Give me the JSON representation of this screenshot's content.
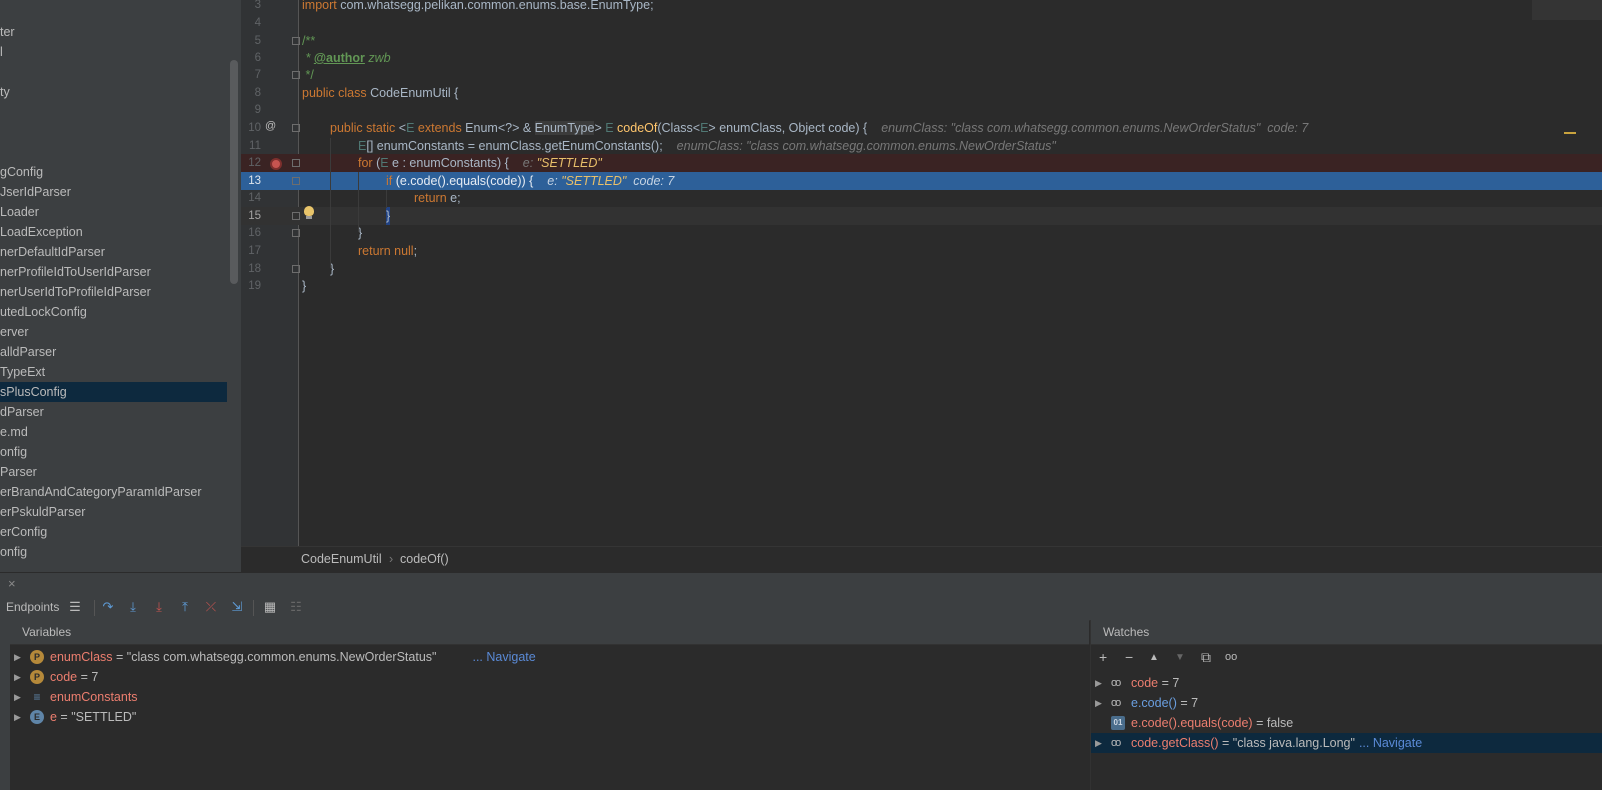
{
  "project_tree": {
    "items": [
      {
        "label": "ter",
        "selected": false
      },
      {
        "label": "l",
        "selected": false
      },
      {
        "label": "",
        "selected": false
      },
      {
        "label": "ty",
        "selected": false
      },
      {
        "label": "",
        "selected": false
      },
      {
        "label": "",
        "selected": false
      },
      {
        "label": "",
        "selected": false
      },
      {
        "label": "gConfig",
        "selected": false
      },
      {
        "label": "JserIdParser",
        "selected": false
      },
      {
        "label": "Loader",
        "selected": false
      },
      {
        "label": "LoadException",
        "selected": false
      },
      {
        "label": "nerDefaultIdParser",
        "selected": false
      },
      {
        "label": "nerProfileIdToUserIdParser",
        "selected": false
      },
      {
        "label": "nerUserIdToProfileIdParser",
        "selected": false
      },
      {
        "label": "utedLockConfig",
        "selected": false
      },
      {
        "label": "erver",
        "selected": false
      },
      {
        "label": "alldParser",
        "selected": false
      },
      {
        "label": "TypeExt",
        "selected": false
      },
      {
        "label": "sPlusConfig",
        "selected": true
      },
      {
        "label": "dParser",
        "selected": false
      },
      {
        "label": "e.md",
        "selected": false
      },
      {
        "label": "onfig",
        "selected": false
      },
      {
        "label": "Parser",
        "selected": false
      },
      {
        "label": "erBrandAndCategoryParamIdParser",
        "selected": false
      },
      {
        "label": "erPskuldParser",
        "selected": false
      },
      {
        "label": "erConfig",
        "selected": false
      },
      {
        "label": "onfig",
        "selected": false
      }
    ]
  },
  "editor": {
    "line_numbers": [
      "3",
      "4",
      "5",
      "6",
      "7",
      "8",
      "9",
      "10",
      "11",
      "12",
      "13",
      "14",
      "15",
      "16",
      "17",
      "18",
      "19"
    ],
    "import_line": {
      "kw": "import",
      "rest": " com.whatsegg.pelikan.common.enums.base.EnumType;"
    },
    "doc_open": "/**",
    "doc_author_prefix": " * ",
    "doc_author_tag": "@author",
    "doc_author_name": " zwb",
    "doc_close": " */",
    "class_line": {
      "kw": "public class",
      "name": " CodeEnumUtil {"
    },
    "method_line": {
      "kw1": "public static",
      "gen_open": " <",
      "gen_e": "E",
      "kw2": " extends",
      "enum_part": " Enum<?> & ",
      "enum_type": "EnumType",
      "gen_close": "> ",
      "ret_e": "E",
      "sp": " ",
      "fn": "codeOf",
      "params": "(Class<",
      "param_e": "E",
      "params2": "> enumClass, Object code) {",
      "inline": "enumClass: \"class com.whatsegg.common.enums.NewOrderStatus\"  code: 7"
    },
    "line11": {
      "e": "E",
      "rest": "[] enumConstants = enumClass.getEnumConstants();",
      "inline": "enumClass: \"class com.whatsegg.common.enums.NewOrderStatus\""
    },
    "line12": {
      "kw": "for",
      "p1": " (",
      "e": "E",
      "rest": " e : enumConstants) {",
      "inline_key": "e: ",
      "inline_val": "\"SETTLED\""
    },
    "line13": {
      "kw": "if",
      "rest": " (e.code().equals(code)) {",
      "inline_key": "e: ",
      "inline_val": "\"SETTLED\"",
      "inline_tail": "  code: 7"
    },
    "line14": {
      "kw": "return",
      "rest": " e;"
    },
    "line15": "}",
    "line16": "}",
    "line17": {
      "kw": "return null",
      "rest": ";"
    },
    "line18": "}",
    "line19": "}",
    "at_marker": "@"
  },
  "breadcrumb": {
    "class_name": "CodeEnumUtil",
    "separator": "›",
    "method_name": "codeOf()"
  },
  "debug": {
    "tab_close": "×",
    "endpoints_label": "Endpoints",
    "variables_title": "Variables",
    "watches_title": "Watches",
    "variables": [
      {
        "icon": "P",
        "name": "enumClass",
        "value": " = \"class com.whatsegg.common.enums.NewOrderStatus\"",
        "navigate": "... Navigate"
      },
      {
        "icon": "P",
        "name": "code",
        "value": " = 7",
        "navigate": ""
      },
      {
        "icon": "≡",
        "name": "enumConstants",
        "value": "",
        "navigate": ""
      },
      {
        "icon": "E",
        "name": "e",
        "value": " = \"SETTLED\"",
        "navigate": ""
      }
    ],
    "watches": [
      {
        "name": "code",
        "value": " = 7",
        "navigate": ""
      },
      {
        "name": "e.code()",
        "value": " = 7",
        "navigate": ""
      },
      {
        "name": "e.code().equals(code)",
        "value": " = false",
        "navigate": ""
      },
      {
        "name": "code.getClass()",
        "value": " = \"class java.lang.Long\"",
        "navigate": "... Navigate"
      }
    ],
    "watch_toolbar": {
      "add": "+",
      "remove": "−",
      "up": "▲",
      "down": "▼",
      "copy": "⧉",
      "glasses": "oo"
    }
  }
}
